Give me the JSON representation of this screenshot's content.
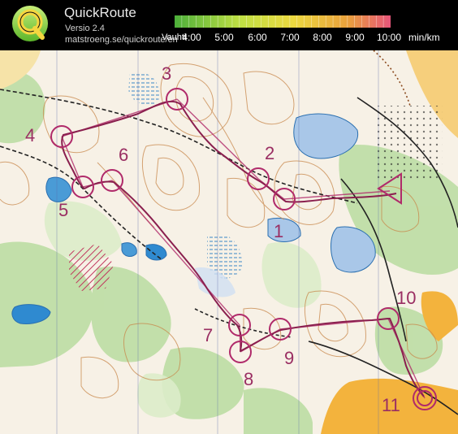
{
  "app": {
    "name": "QuickRoute",
    "version": "Versio 2.4",
    "url": "matstroeng.se/quickroute/en"
  },
  "pace_legend": {
    "title": "Vauhti",
    "ticks": [
      "4:00",
      "5:00",
      "6:00",
      "7:00",
      "8:00",
      "9:00",
      "10:00"
    ],
    "unit": "min/km",
    "gradient_colors": [
      "#4caf3a",
      "#bfe044",
      "#ecd940",
      "#e9a13c",
      "#e6557a"
    ]
  },
  "controls": [
    {
      "label": "1",
      "description": "control-1"
    },
    {
      "label": "2",
      "description": "control-2"
    },
    {
      "label": "3",
      "description": "control-3"
    },
    {
      "label": "4",
      "description": "control-4"
    },
    {
      "label": "5",
      "description": "control-5"
    },
    {
      "label": "6",
      "description": "control-6"
    },
    {
      "label": "7",
      "description": "control-7"
    },
    {
      "label": "8",
      "description": "control-8"
    },
    {
      "label": "9",
      "description": "control-9"
    },
    {
      "label": "10",
      "description": "control-10"
    },
    {
      "label": "11",
      "description": "control-11"
    }
  ],
  "colors": {
    "control_ring": "#b02a6a",
    "route_line": "#8a1f4e",
    "lake": "#a9c7e8",
    "marsh": "#4a9bd6",
    "forest_green": "#a8cf8d",
    "open_land": "#f3b33d"
  }
}
